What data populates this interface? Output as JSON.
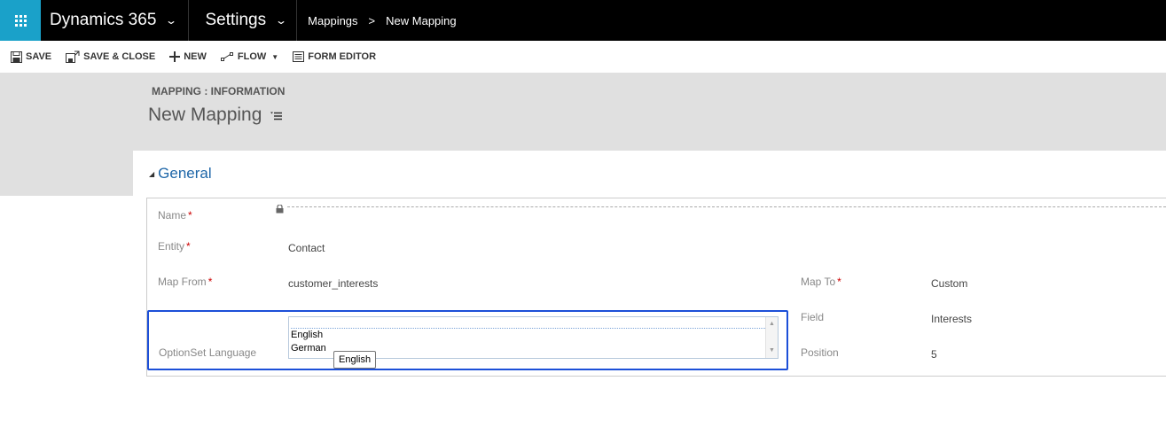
{
  "topbar": {
    "app_name": "Dynamics 365",
    "area": "Settings",
    "breadcrumb": [
      "Mappings",
      "New Mapping"
    ]
  },
  "commands": [
    {
      "label": "SAVE",
      "icon": "save-icon"
    },
    {
      "label": "SAVE & CLOSE",
      "icon": "save-close-icon"
    },
    {
      "label": "NEW",
      "icon": "plus-icon"
    },
    {
      "label": "FLOW",
      "icon": "flow-icon"
    },
    {
      "label": "FORM EDITOR",
      "icon": "form-editor-icon"
    }
  ],
  "header": {
    "form_type": "MAPPING : INFORMATION",
    "title": "New Mapping"
  },
  "section": {
    "title": "General"
  },
  "fields": {
    "name": {
      "label": "Name",
      "value": ""
    },
    "entity": {
      "label": "Entity",
      "value": "Contact"
    },
    "map_from": {
      "label": "Map From",
      "value": "customer_interests"
    },
    "map_to": {
      "label": "Map To",
      "value": "Custom"
    },
    "field": {
      "label": "Field",
      "value": "Interests"
    },
    "position": {
      "label": "Position",
      "value": "5"
    },
    "optionset_language": {
      "label": "OptionSet Language",
      "options": [
        "English",
        "German"
      ],
      "tooltip": "English"
    }
  },
  "colors": {
    "topbar": "#000000",
    "waffle": "#1aa1c9",
    "header_band": "#e0e0e0",
    "section_title": "#1e66a8",
    "highlight": "#1c4fd8",
    "required": "#cc0000"
  }
}
